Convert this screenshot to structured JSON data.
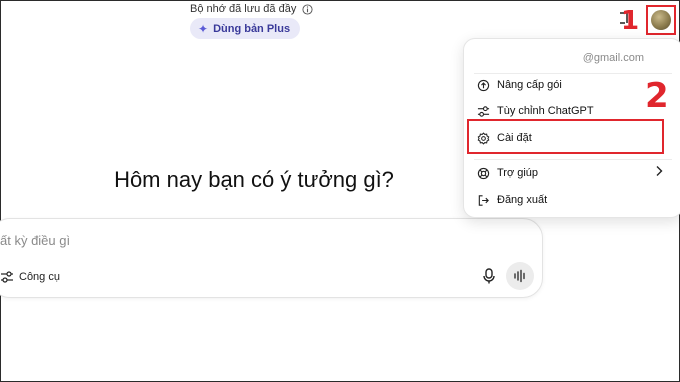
{
  "header": {
    "memory_note": "Bộ nhớ đã lưu đã đầy",
    "upgrade_button": "Dùng bản Plus"
  },
  "main": {
    "headline": "Hôm nay bạn có ý tưởng gì?"
  },
  "composer": {
    "placeholder": "ất kỳ điều gì",
    "tools_label": "Công cụ"
  },
  "markers": {
    "step1": "1",
    "step2": "2"
  },
  "account_menu": {
    "email": "@gmail.com",
    "items": [
      {
        "label": "Nâng cấp gói",
        "icon": "upgrade-icon"
      },
      {
        "label": "Tùy chỉnh ChatGPT",
        "icon": "sliders-icon"
      },
      {
        "label": "Cài đặt",
        "icon": "gear-icon"
      },
      {
        "label": "Trợ giúp",
        "icon": "lifebuoy-icon"
      },
      {
        "label": "Đăng xuất",
        "icon": "logout-icon"
      }
    ]
  },
  "colors": {
    "highlight": "#e0262d",
    "plus_bg": "#e9e9f8",
    "plus_text": "#3a3a9a"
  }
}
